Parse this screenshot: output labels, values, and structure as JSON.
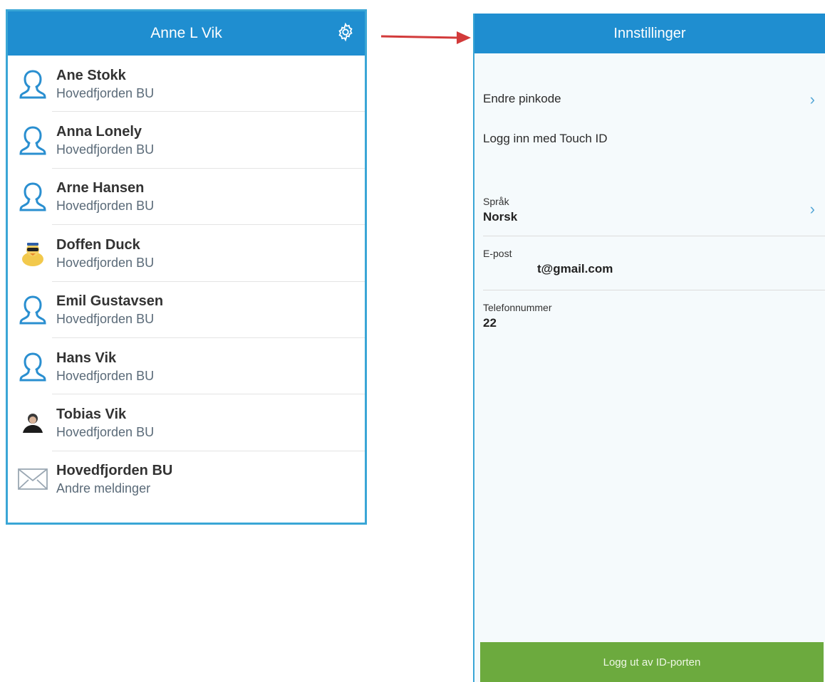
{
  "left": {
    "title": "Anne L Vik",
    "settings_icon": "gear-icon",
    "contacts": [
      {
        "name": "Ane Stokk",
        "group": "Hovedfjorden BU",
        "avatar": "person-outline-icon"
      },
      {
        "name": "Anna Lonely",
        "group": "Hovedfjorden BU",
        "avatar": "person-outline-icon"
      },
      {
        "name": "Arne Hansen",
        "group": "Hovedfjorden BU",
        "avatar": "person-outline-icon"
      },
      {
        "name": "Doffen Duck",
        "group": "Hovedfjorden BU",
        "avatar": "duck-photo"
      },
      {
        "name": "Emil Gustavsen",
        "group": "Hovedfjorden BU",
        "avatar": "person-outline-icon"
      },
      {
        "name": "Hans Vik",
        "group": "Hovedfjorden BU",
        "avatar": "person-outline-icon"
      },
      {
        "name": "Tobias Vik",
        "group": "Hovedfjorden BU",
        "avatar": "person-photo"
      },
      {
        "name": "Hovedfjorden BU",
        "group": "Andre meldinger",
        "avatar": "envelope-icon"
      }
    ]
  },
  "right": {
    "title": "Innstillinger",
    "change_pin": "Endre pinkode",
    "touch_id": "Logg inn med Touch ID",
    "language_label": "Språk",
    "language_value": "Norsk",
    "email_label": "E-post",
    "email_value": "t@gmail.com",
    "phone_label": "Telefonnummer",
    "phone_value": "22",
    "logout_label": "Logg ut av ID-porten"
  },
  "colors": {
    "header_blue": "#1f8ed0",
    "border_blue": "#3aa6d6",
    "logout_green": "#6caa3e",
    "arrow_red": "#d23a3a"
  }
}
